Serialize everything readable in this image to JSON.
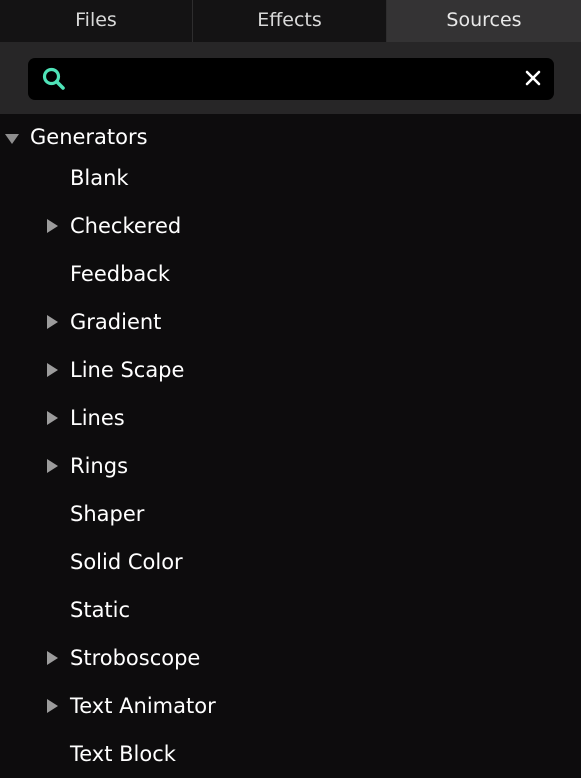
{
  "tabs": [
    {
      "label": "Files"
    },
    {
      "label": "Effects"
    },
    {
      "label": "Sources",
      "active": true
    }
  ],
  "search": {
    "value": "",
    "placeholder": "",
    "icon": "search-icon",
    "clear_icon": "close-icon",
    "icon_color": "#4fe3b8"
  },
  "tree": {
    "root": {
      "label": "Generators",
      "expanded": true
    },
    "items": [
      {
        "label": "Blank",
        "expandable": false
      },
      {
        "label": "Checkered",
        "expandable": true
      },
      {
        "label": "Feedback",
        "expandable": false
      },
      {
        "label": "Gradient",
        "expandable": true
      },
      {
        "label": "Line Scape",
        "expandable": true
      },
      {
        "label": "Lines",
        "expandable": true
      },
      {
        "label": "Rings",
        "expandable": true
      },
      {
        "label": "Shaper",
        "expandable": false
      },
      {
        "label": "Solid Color",
        "expandable": false
      },
      {
        "label": "Static",
        "expandable": false
      },
      {
        "label": "Stroboscope",
        "expandable": true
      },
      {
        "label": "Text Animator",
        "expandable": true
      },
      {
        "label": "Text Block",
        "expandable": false
      }
    ]
  }
}
